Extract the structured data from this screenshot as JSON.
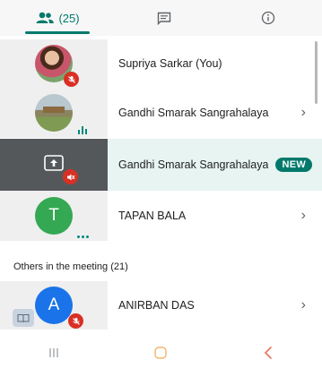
{
  "tabs": {
    "people_count": "(25)",
    "chat_label": "",
    "info_label": ""
  },
  "participants": [
    {
      "name": "Supriya Sarkar (You)"
    },
    {
      "name": "Gandhi Smarak Sangrahalaya"
    },
    {
      "name": "Gandhi Smarak Sangrahalaya",
      "badge": "NEW"
    },
    {
      "name": "TAPAN BALA",
      "initial": "T"
    }
  ],
  "others": {
    "label": "Others in the meeting (21)",
    "items": [
      {
        "name": "ANIRBAN DAS",
        "initial": "A"
      }
    ]
  },
  "colors": {
    "accent": "#00796b",
    "mute": "#d93025",
    "avatar_t": "#34a853",
    "avatar_a": "#1a73e8"
  },
  "icons": {
    "people_tab": "people-icon",
    "chat_tab": "chat-icon",
    "info_tab": "info-icon",
    "mic_off": "mic-off-icon",
    "speaking": "audio-level-icon",
    "present": "present-screen-icon",
    "volume_off": "volume-off-icon",
    "more": "more-dots-icon",
    "chevron": "chevron-right-icon"
  }
}
